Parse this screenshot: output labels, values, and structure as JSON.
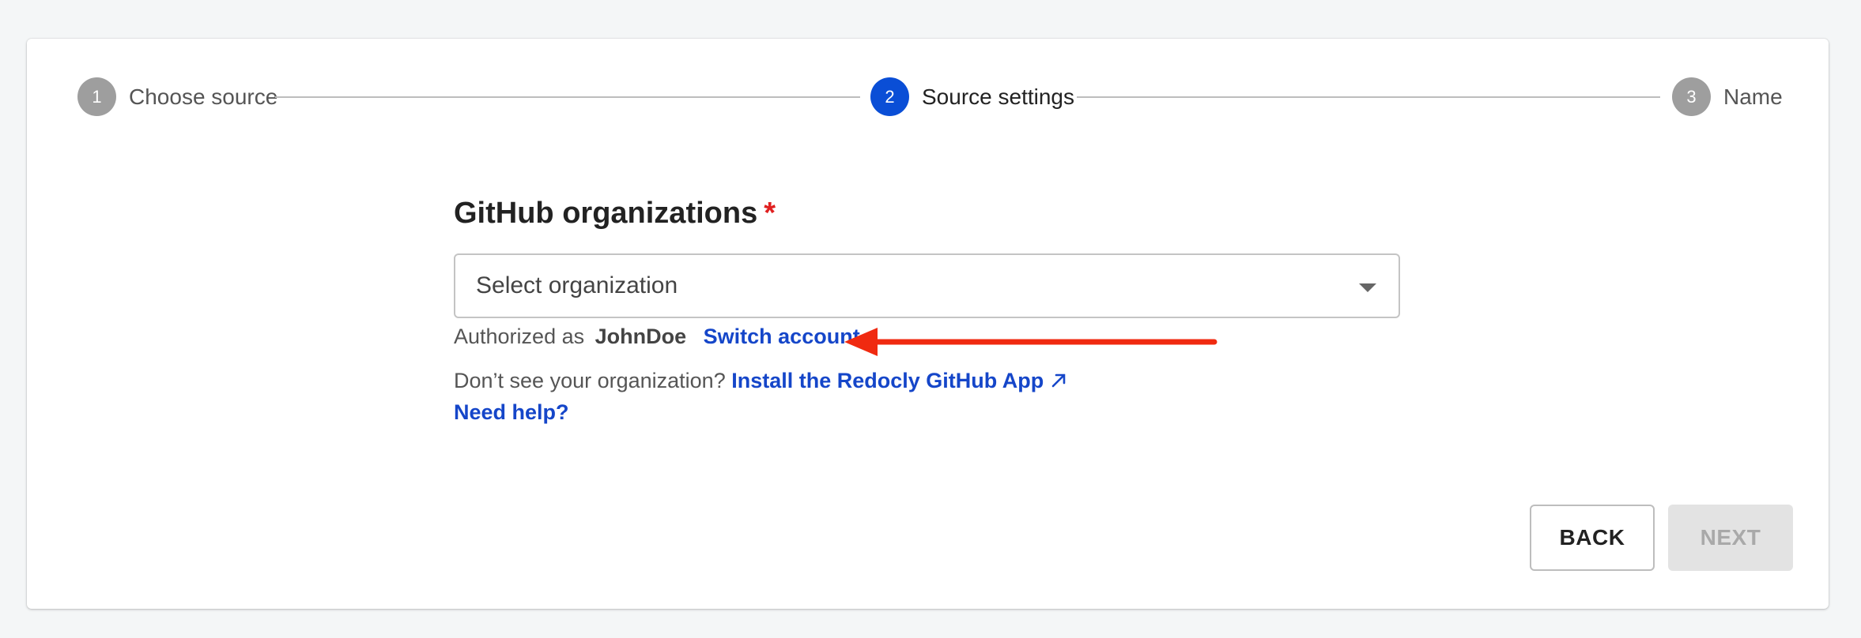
{
  "stepper": {
    "steps": [
      {
        "number": "1",
        "label": "Choose source"
      },
      {
        "number": "2",
        "label": "Source settings"
      },
      {
        "number": "3",
        "label": "Name"
      }
    ],
    "active_step": 2
  },
  "form": {
    "field_label": "GitHub organizations",
    "required_marker": "*",
    "select": {
      "placeholder": "Select organization"
    },
    "auth": {
      "prefix": "Authorized as",
      "username": "JohnDoe",
      "switch_link": "Switch account."
    },
    "help": {
      "question": "Don’t see your organization?",
      "install_link": "Install the Redocly GitHub App",
      "need_help_link": "Need help?"
    }
  },
  "actions": {
    "back_label": "BACK",
    "next_label": "NEXT"
  },
  "colors": {
    "accent": "#0a4ed6",
    "link": "#1546c9",
    "required": "#e02020",
    "annotation_arrow": "#f02a10"
  },
  "icons": {
    "select_caret": "caret-down-icon",
    "external_link": "external-link-icon",
    "annotation": "red-arrow-pointer"
  }
}
